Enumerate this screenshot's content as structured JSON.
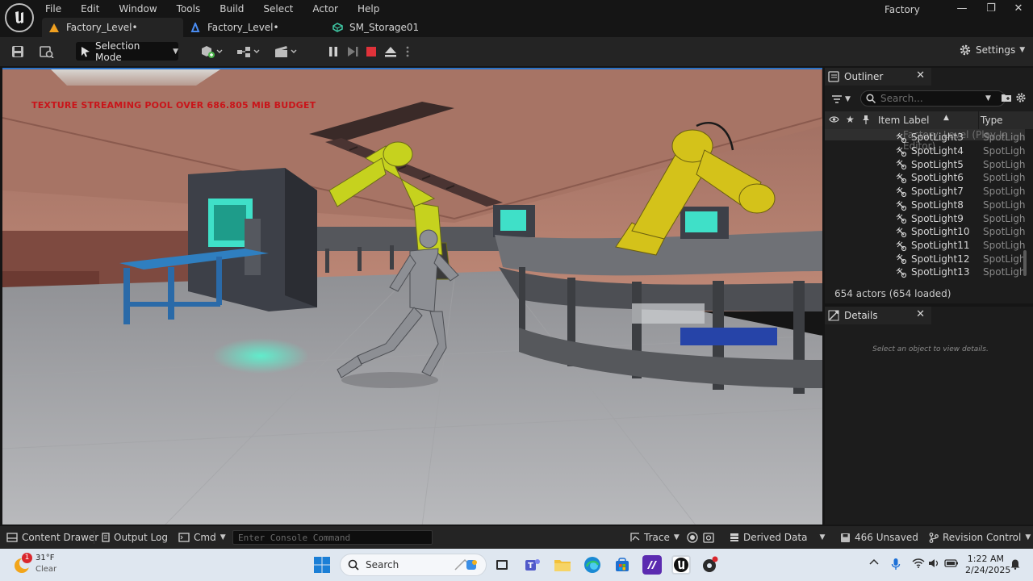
{
  "window": {
    "title": "Factory",
    "menu": [
      "File",
      "Edit",
      "Window",
      "Tools",
      "Build",
      "Select",
      "Actor",
      "Help"
    ],
    "controls": {
      "minimize": "—",
      "restore": "❐",
      "close": "✕"
    }
  },
  "tabs": [
    {
      "label": "Factory_Level•",
      "icon": "level-warning-icon",
      "active": true
    },
    {
      "label": "Factory_Level•",
      "icon": "blueprint-level-icon",
      "active": false
    },
    {
      "label": "SM_Storage01",
      "icon": "static-mesh-icon",
      "active": false
    }
  ],
  "toolbar": {
    "selection_mode": "Selection Mode",
    "settings": "Settings"
  },
  "viewport": {
    "warning": "TEXTURE STREAMING POOL OVER 686.805 MiB BUDGET"
  },
  "outliner": {
    "title": "Outliner",
    "search_placeholder": "Search...",
    "columns": {
      "label": "Item Label",
      "type": "Type"
    },
    "root": "Factory_Level (Play In Editor)",
    "rows": [
      {
        "label": "SpotLight3",
        "type": "SpotLigh"
      },
      {
        "label": "SpotLight4",
        "type": "SpotLigh"
      },
      {
        "label": "SpotLight5",
        "type": "SpotLigh"
      },
      {
        "label": "SpotLight6",
        "type": "SpotLigh"
      },
      {
        "label": "SpotLight7",
        "type": "SpotLigh"
      },
      {
        "label": "SpotLight8",
        "type": "SpotLigh"
      },
      {
        "label": "SpotLight9",
        "type": "SpotLigh"
      },
      {
        "label": "SpotLight10",
        "type": "SpotLigh"
      },
      {
        "label": "SpotLight11",
        "type": "SpotLigh"
      },
      {
        "label": "SpotLight12",
        "type": "SpotLigh"
      },
      {
        "label": "SpotLight13",
        "type": "SpotLigh"
      }
    ],
    "actor_count": "654 actors (654 loaded)"
  },
  "details": {
    "title": "Details",
    "empty": "Select an object to view details."
  },
  "statusbar": {
    "content_drawer": "Content Drawer",
    "output_log": "Output Log",
    "cmd": "Cmd",
    "console_placeholder": "Enter Console Command",
    "trace": "Trace",
    "derived_data": "Derived Data",
    "unsaved": "466 Unsaved",
    "revision_control": "Revision Control"
  },
  "taskbar": {
    "weather_temp": "31°F",
    "weather_desc": "Clear",
    "weather_badge": "1",
    "search": "Search",
    "time": "1:22 AM",
    "date": "2/24/2025"
  },
  "colors": {
    "accent_blue": "#2b73c9",
    "warning_red": "#c9151a",
    "stop_red": "#e0323a",
    "robot_yellow": "#d4c21a",
    "screen_cyan": "#3fe0c8"
  }
}
